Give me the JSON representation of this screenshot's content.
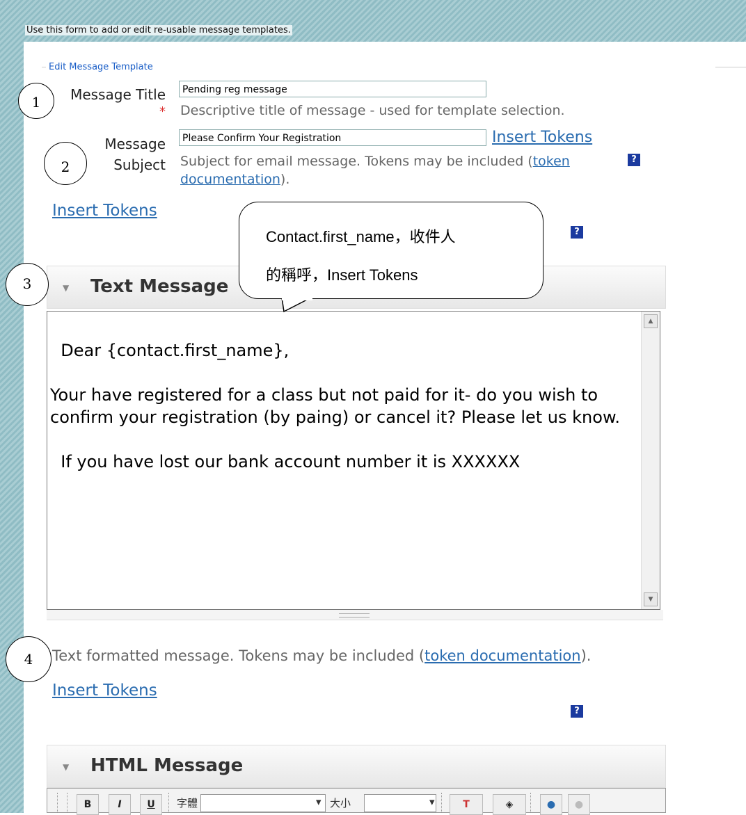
{
  "intro_text": "Use this form to add or edit re-usable message templates.",
  "form": {
    "legend": "Edit Message Template",
    "title_label": "Message Title",
    "required_mark": "*",
    "title_value": "Pending reg message",
    "title_desc": "Descriptive title of message - used for template selection.",
    "subject_label_1": "Message",
    "subject_label_2": "Subject",
    "subject_value": "Please Confirm Your Registration",
    "subject_insert_tokens": "Insert Tokens",
    "subject_desc_pre": "Subject for email message. Tokens may be included (",
    "subject_desc_link_1": "token",
    "subject_desc_link_2": "documentation",
    "subject_desc_post": ").",
    "help_icon": "?"
  },
  "text_section": {
    "insert_tokens": "Insert Tokens",
    "help_icon": "?",
    "arrow": "▼",
    "title": "Text Message",
    "body": "Dear {contact.first_name},\n\nYour have registered for a class but not paid for it- do you wish to confirm your registration (by paing) or cancel it? Please let us know.\n\n  If you have lost our bank account number it is XXXXXX",
    "desc_pre": "Text formatted message. Tokens may be included (",
    "desc_link": "token documentation",
    "desc_post": ")."
  },
  "html_section": {
    "insert_tokens": "Insert Tokens",
    "help_icon": "?",
    "arrow": "▼",
    "title": "HTML Message",
    "toolbar": {
      "bold": "B",
      "italic": "I",
      "underline": "U",
      "font_label": "字體",
      "size_label": "大小",
      "text_color": "T",
      "bg_color": "◈"
    }
  },
  "annotations": {
    "circle_1": "1",
    "circle_2": "2",
    "circle_3": "3",
    "circle_4": "4",
    "callout_line_1": "Contact.first_name，收件人",
    "callout_line_2": "的稱呼，Insert Tokens"
  }
}
